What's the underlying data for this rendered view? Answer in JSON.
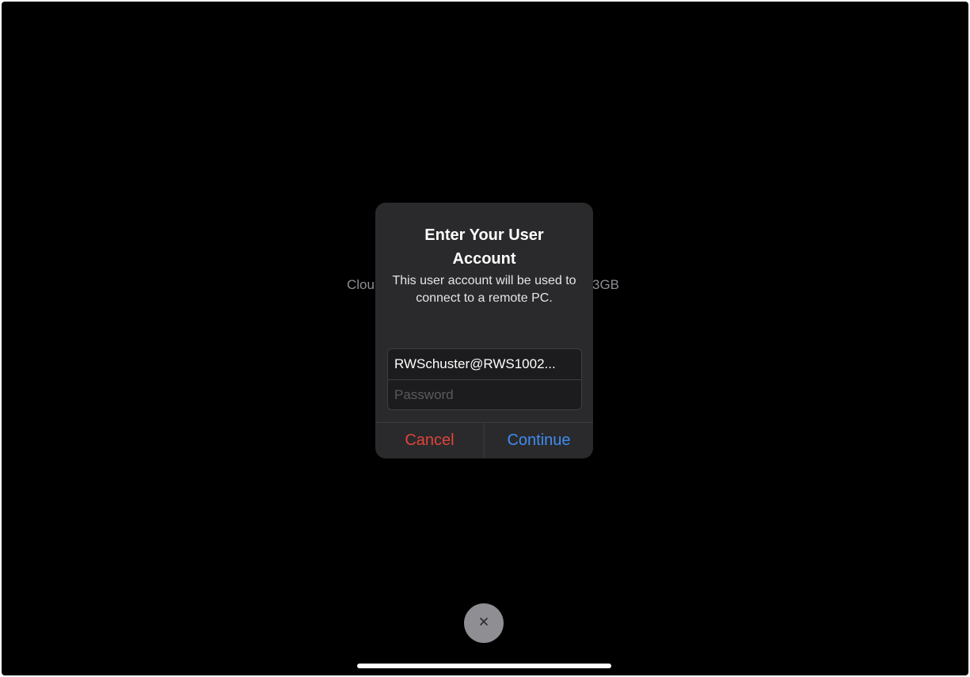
{
  "background": {
    "left_text": "Clou",
    "right_text": "3GB"
  },
  "dialog": {
    "title": "Enter Your User Account",
    "message": "This user account will be used to connect to a remote PC.",
    "username_value": "RWSchuster@RWS1002...",
    "password_placeholder": "Password",
    "cancel_label": "Cancel",
    "continue_label": "Continue"
  },
  "close_button": {
    "icon": "close-icon"
  },
  "colors": {
    "cancel": "#e0443a",
    "continue": "#3f8cf0",
    "dialog_bg": "#2a2a2c",
    "screen_bg": "#000000"
  }
}
